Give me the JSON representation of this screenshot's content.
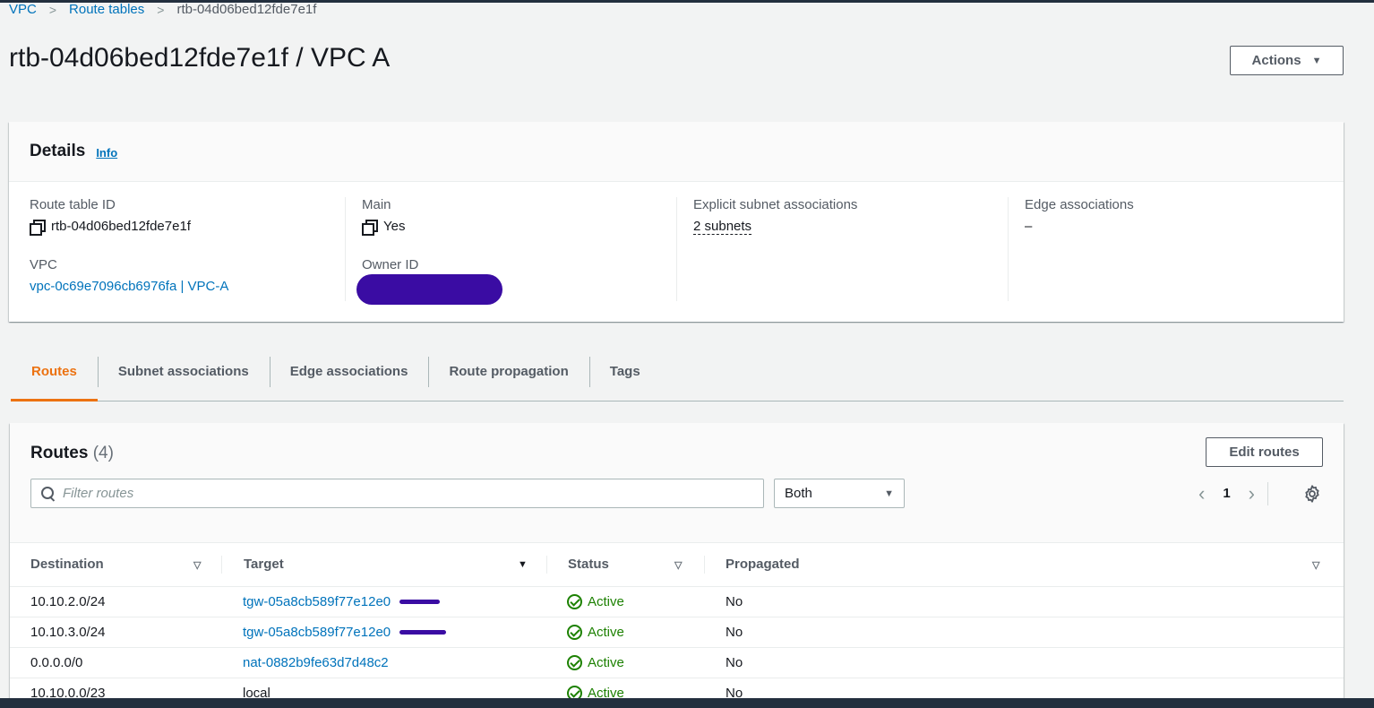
{
  "breadcrumb": {
    "vpc": "VPC",
    "route_tables": "Route tables",
    "current": "rtb-04d06bed12fde7e1f"
  },
  "page": {
    "title": "rtb-04d06bed12fde7e1f / VPC A",
    "actions_label": "Actions"
  },
  "details": {
    "heading": "Details",
    "info": "Info",
    "route_table_id_label": "Route table ID",
    "route_table_id": "rtb-04d06bed12fde7e1f",
    "main_label": "Main",
    "main_value": "Yes",
    "explicit_label": "Explicit subnet associations",
    "explicit_value": "2 subnets",
    "edge_label": "Edge associations",
    "edge_value": "–",
    "vpc_label": "VPC",
    "vpc_value": "vpc-0c69e7096cb6976fa | VPC-A",
    "owner_label": "Owner ID"
  },
  "tabs": [
    "Routes",
    "Subnet associations",
    "Edge associations",
    "Route propagation",
    "Tags"
  ],
  "routes": {
    "title": "Routes",
    "count": "(4)",
    "edit_label": "Edit routes",
    "filter_placeholder": "Filter routes",
    "select_value": "Both",
    "page": "1",
    "columns": [
      "Destination",
      "Target",
      "Status",
      "Propagated"
    ],
    "rows": [
      {
        "destination": "10.10.2.0/24",
        "target": "tgw-05a8cb589f77e12e0",
        "status": "Active",
        "propagated": "No"
      },
      {
        "destination": "10.10.3.0/24",
        "target": "tgw-05a8cb589f77e12e0",
        "status": "Active",
        "propagated": "No"
      },
      {
        "destination": "0.0.0.0/0",
        "target": "nat-0882b9fe63d7d48c2",
        "status": "Active",
        "propagated": "No"
      },
      {
        "destination": "10.10.0.0/23",
        "target": "local",
        "status": "Active",
        "propagated": "No"
      }
    ]
  },
  "colors": {
    "link": "#0073bb",
    "active_tab": "#ec7211",
    "status_ok": "#1d8102",
    "redaction": "#3a0ca3"
  }
}
